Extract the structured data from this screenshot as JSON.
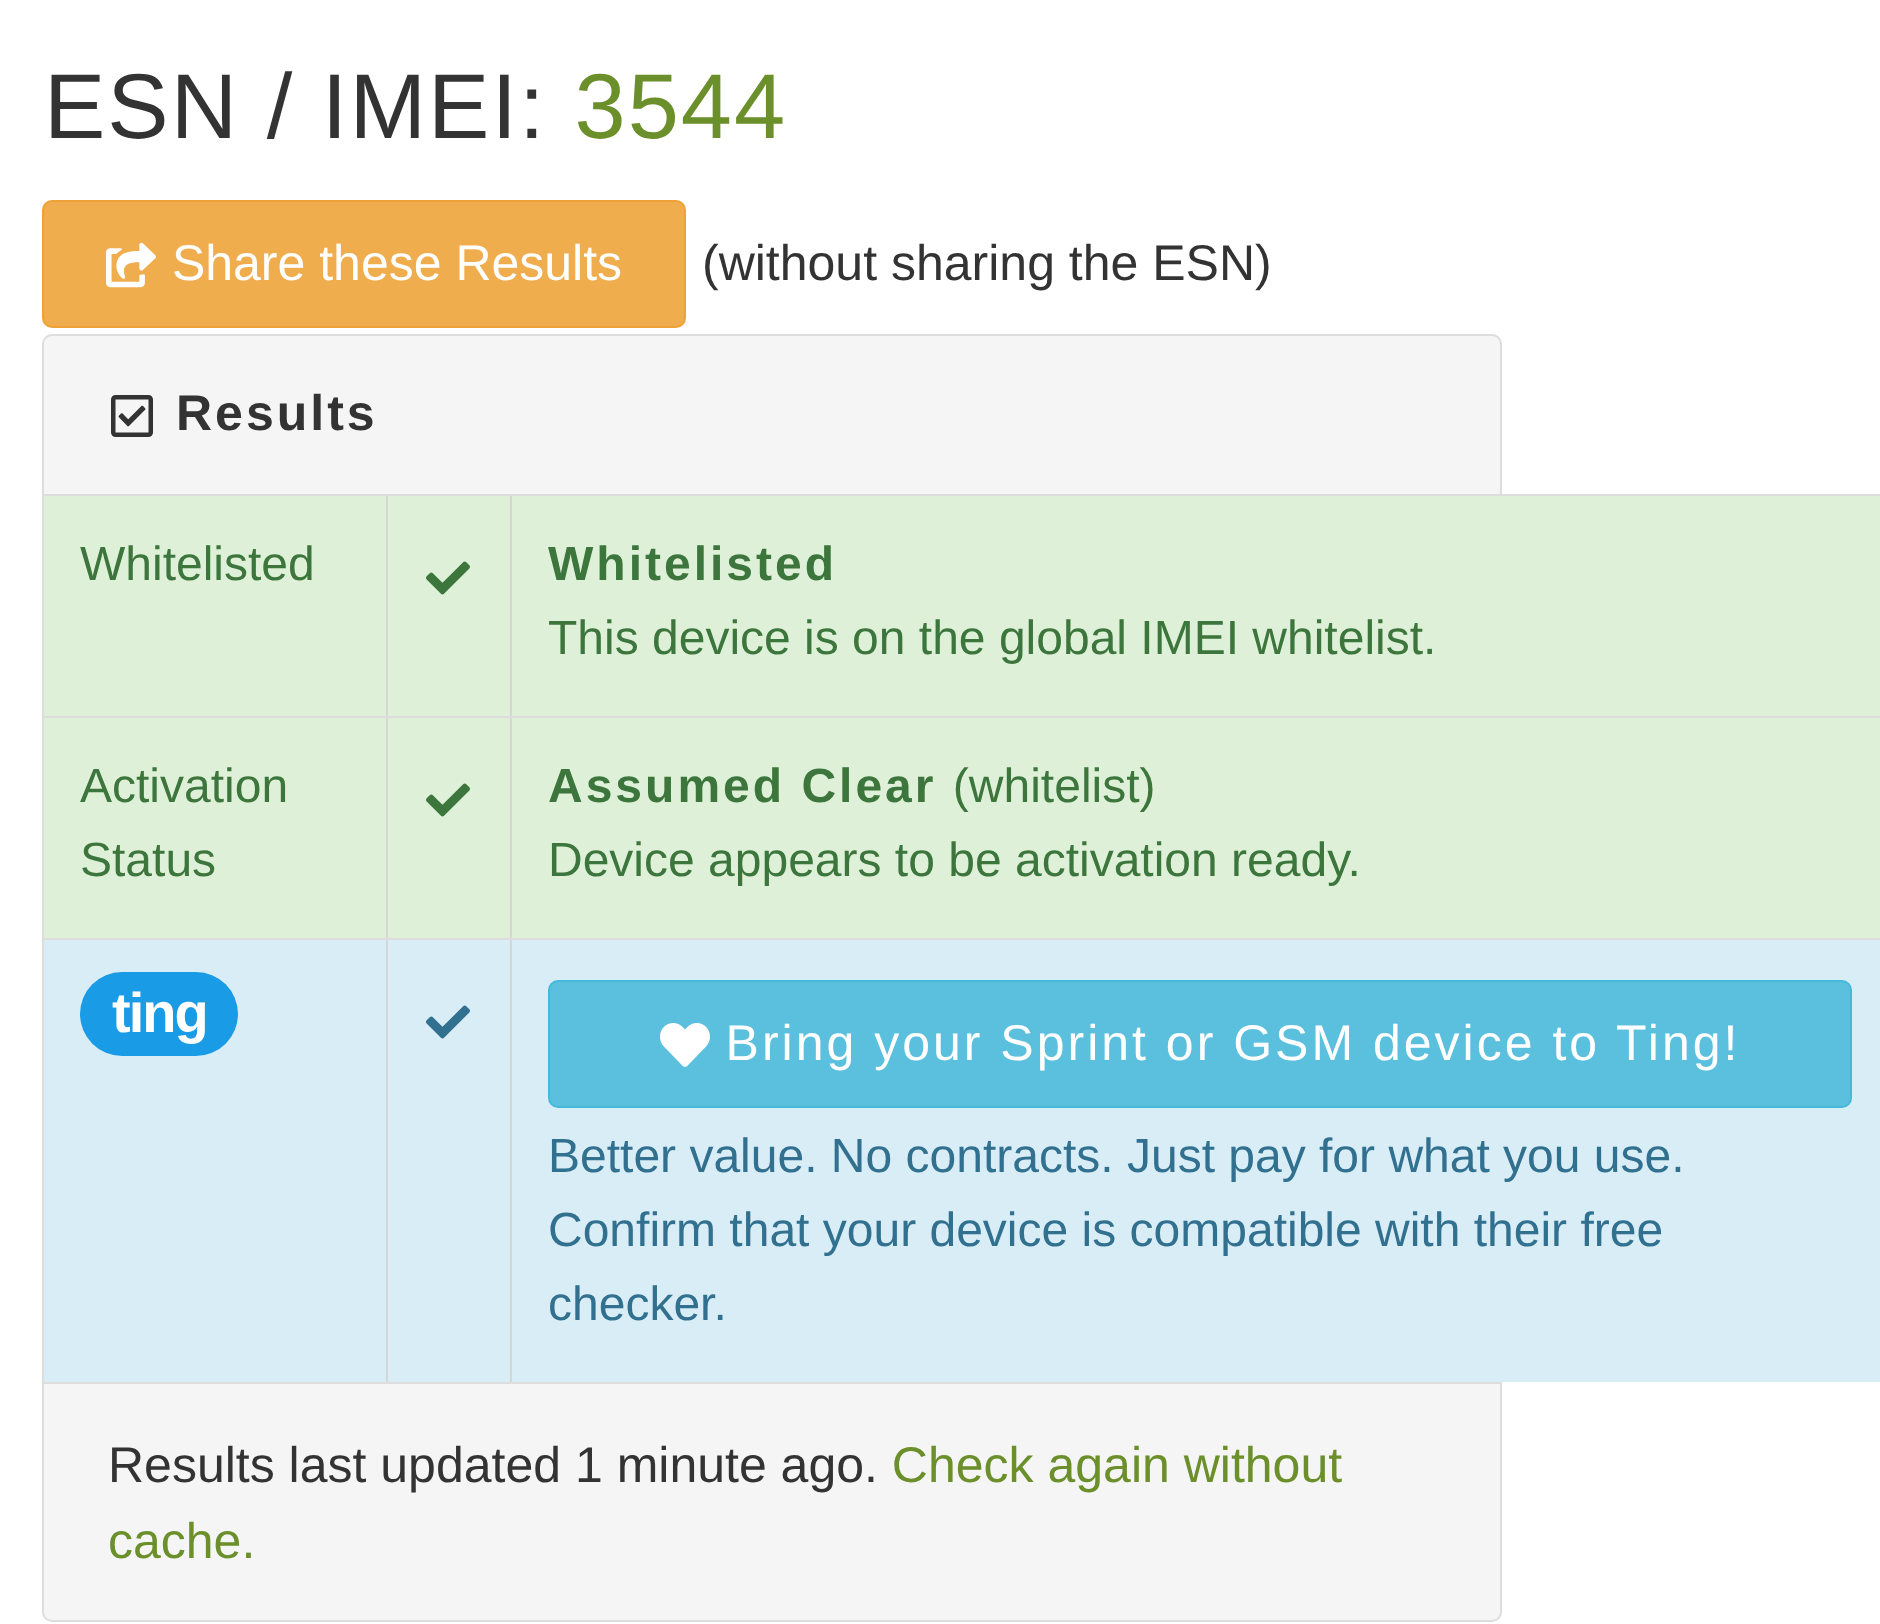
{
  "heading": {
    "label": "ESN / IMEI:",
    "value": "3544"
  },
  "share": {
    "button": "Share these Results",
    "note": "(without sharing the ESN)"
  },
  "panel": {
    "title": "Results"
  },
  "rows": [
    {
      "kind": "status",
      "label": "Whitelisted",
      "checked": true,
      "title": "Whitelisted",
      "title_note": "",
      "description": "This device is on the global IMEI whitelist."
    },
    {
      "kind": "status",
      "label": "Activation Status",
      "checked": true,
      "title": "Assumed Clear",
      "title_note": "(whitelist)",
      "description": "Device appears to be activation ready."
    },
    {
      "kind": "offer",
      "logo": "ting",
      "checked": true,
      "button": "Bring your Sprint or GSM device to Ting!",
      "description": "Better value. No contracts. Just pay for what you use. Confirm that your device is compatible with their free checker."
    }
  ],
  "footer": {
    "text": "Results last updated 1 minute ago.",
    "link_lines": [
      "Check again without",
      "cache."
    ]
  }
}
